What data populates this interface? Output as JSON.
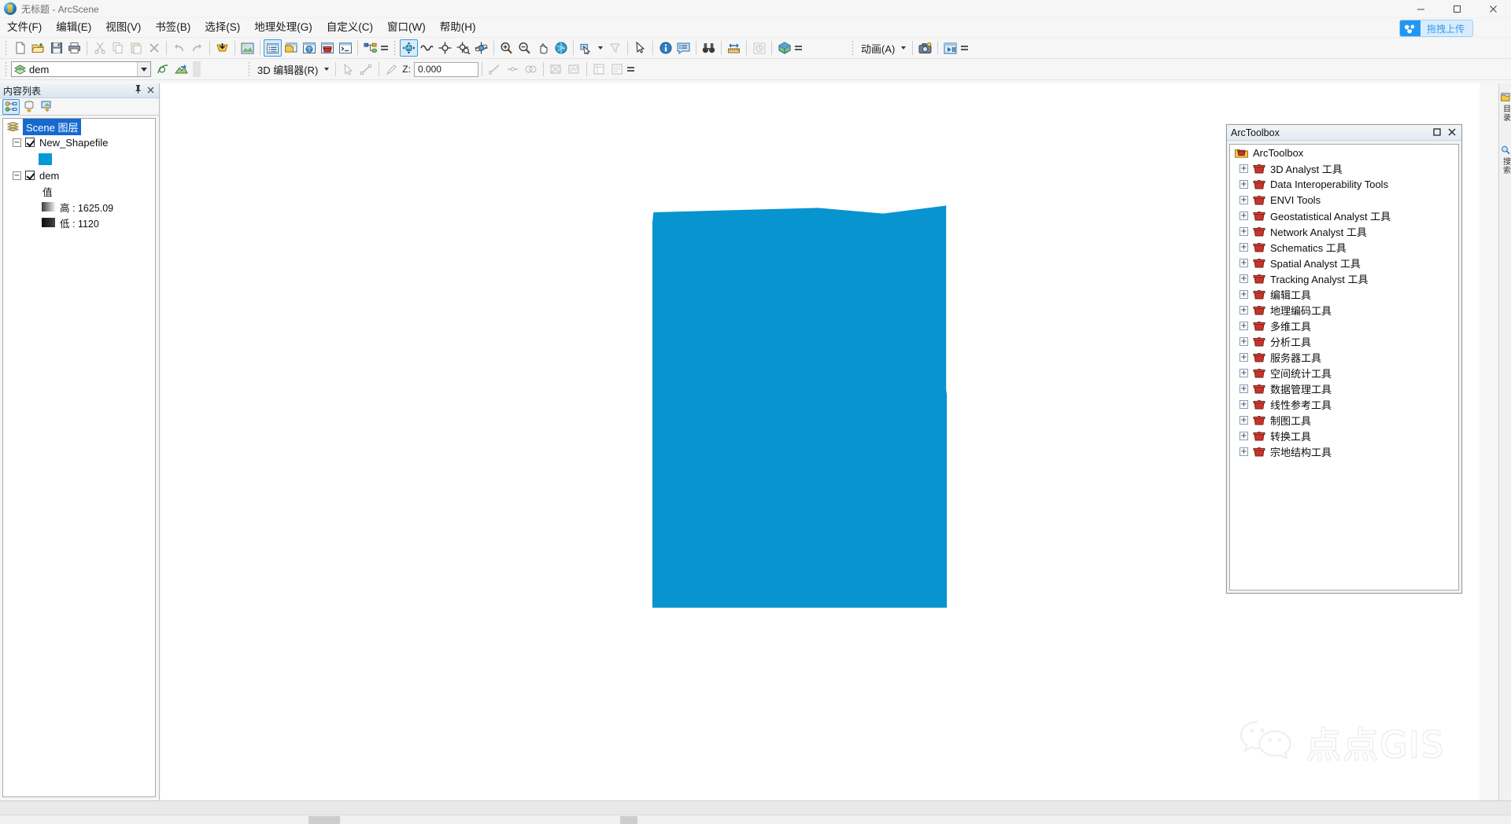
{
  "window": {
    "title": "无标题 - ArcScene",
    "app_icon": "arcscene-globe-icon",
    "minimize": "minimize-button",
    "maximize": "maximize-button",
    "close": "close-button"
  },
  "menubar": {
    "items": [
      {
        "label": "文件(F)",
        "name": "menu-file"
      },
      {
        "label": "编辑(E)",
        "name": "menu-edit"
      },
      {
        "label": "视图(V)",
        "name": "menu-view"
      },
      {
        "label": "书签(B)",
        "name": "menu-bookmarks"
      },
      {
        "label": "选择(S)",
        "name": "menu-selection"
      },
      {
        "label": "地理处理(G)",
        "name": "menu-geoprocessing"
      },
      {
        "label": "自定义(C)",
        "name": "menu-customize"
      },
      {
        "label": "窗口(W)",
        "name": "menu-window"
      },
      {
        "label": "帮助(H)",
        "name": "menu-help"
      }
    ],
    "upload_button": {
      "label": "拖拽上传",
      "icon": "baidu-netdisk-icon",
      "accent": "#2196f3",
      "background": "#d8ecff"
    }
  },
  "toolbar_standard": {
    "buttons": [
      {
        "name": "new-document-button",
        "icon": "new-document-icon"
      },
      {
        "name": "open-document-button",
        "icon": "open-folder-icon"
      },
      {
        "name": "save-document-button",
        "icon": "floppy-disk-icon"
      },
      {
        "name": "print-button",
        "icon": "printer-icon"
      },
      {
        "name": "cut-button",
        "icon": "scissors-icon"
      },
      {
        "name": "copy-button",
        "icon": "copy-icon"
      },
      {
        "name": "paste-button",
        "icon": "clipboard-paste-icon"
      },
      {
        "name": "delete-button",
        "icon": "x-delete-icon"
      },
      {
        "name": "undo-button",
        "icon": "undo-arrow-icon"
      },
      {
        "name": "redo-button",
        "icon": "redo-arrow-icon"
      },
      {
        "name": "add-data-button",
        "icon": "add-data-icon"
      },
      {
        "name": "base-layer-button",
        "icon": "picture-icon"
      },
      {
        "name": "table-of-contents-button",
        "icon": "toc-icon"
      },
      {
        "name": "catalog-button",
        "icon": "catalog-icon"
      },
      {
        "name": "search-window-button",
        "icon": "search-globe-icon"
      },
      {
        "name": "arctoolbox-button",
        "icon": "toolbox-icon"
      },
      {
        "name": "python-window-button",
        "icon": "python-console-icon"
      },
      {
        "name": "model-builder-button",
        "icon": "modelbuilder-icon"
      }
    ],
    "navigate_buttons": [
      {
        "name": "navigate-tool-button",
        "icon": "navigate-globe-icon"
      },
      {
        "name": "fly-tool-button",
        "icon": "fly-icon"
      },
      {
        "name": "center-on-target-button",
        "icon": "center-target-icon"
      },
      {
        "name": "zoom-to-target-button",
        "icon": "zoom-target-icon"
      },
      {
        "name": "set-observer-button",
        "icon": "observer-icon"
      },
      {
        "name": "zoom-in-button",
        "icon": "zoom-in-icon"
      },
      {
        "name": "zoom-out-button",
        "icon": "zoom-out-icon"
      },
      {
        "name": "zoom-in-tool-button",
        "icon": "magnifier-plus-icon"
      },
      {
        "name": "zoom-out-tool-button",
        "icon": "magnifier-minus-icon"
      },
      {
        "name": "pan-button",
        "icon": "hand-pan-icon"
      },
      {
        "name": "full-extent-button",
        "icon": "globe-full-extent-icon"
      },
      {
        "name": "select-features-button",
        "icon": "select-features-icon"
      },
      {
        "name": "clear-selection-button",
        "icon": "clear-selection-icon"
      },
      {
        "name": "select-elements-button",
        "icon": "arrow-pointer-icon"
      },
      {
        "name": "identify-button",
        "icon": "info-identify-icon"
      },
      {
        "name": "html-popup-button",
        "icon": "html-popup-icon"
      },
      {
        "name": "find-button",
        "icon": "binoculars-icon"
      },
      {
        "name": "measure-button",
        "icon": "measure-ruler-icon"
      },
      {
        "name": "time-slider-button",
        "icon": "clock-icon"
      },
      {
        "name": "scene-properties-button",
        "icon": "cube-icon"
      }
    ],
    "animation": {
      "label": "动画(A)",
      "buttons": [
        {
          "name": "capture-view-button",
          "icon": "camera-icon"
        },
        {
          "name": "animation-controls-button",
          "icon": "play-pause-icon"
        }
      ]
    }
  },
  "toolbar_3d_editor": {
    "layer_combo": {
      "value": "dem",
      "icon": "raster-layer-icon",
      "name": "layer-dropdown"
    },
    "extra_buttons": [
      {
        "name": "edit-vertices-button",
        "icon": "vertices-icon"
      },
      {
        "name": "drape-button",
        "icon": "drape-icon"
      }
    ],
    "label": "3D 编辑器(R)",
    "z_label": "Z:",
    "z_value": "0.000",
    "z_placeholder": "0.000",
    "buttons": [
      {
        "name": "edit-tool-button",
        "icon": "edit-pointer-icon"
      },
      {
        "name": "edit-vertices-tool-button",
        "icon": "edit-vertices-icon"
      },
      {
        "name": "sketch-tool-button",
        "icon": "sketch-pencil-icon"
      },
      {
        "name": "straight-segment-button",
        "icon": "straight-segment-icon"
      },
      {
        "name": "midpoint-button",
        "icon": "midpoint-icon"
      },
      {
        "name": "distance-distance-button",
        "icon": "distance-distance-icon"
      },
      {
        "name": "intersection-button",
        "icon": "intersection-icon"
      },
      {
        "name": "trace-button",
        "icon": "trace-icon"
      },
      {
        "name": "attributes-button",
        "icon": "attributes-icon"
      },
      {
        "name": "sketch-properties-button",
        "icon": "sketch-properties-icon"
      }
    ]
  },
  "toc": {
    "title": "内容列表",
    "pin_icon": "pin-icon",
    "close_icon": "close-icon",
    "tools": [
      {
        "name": "list-by-drawing-order-button",
        "icon": "list-drawing-order-icon",
        "selected": true
      },
      {
        "name": "list-by-source-button",
        "icon": "list-source-icon",
        "selected": false
      },
      {
        "name": "list-by-selection-button",
        "icon": "list-selection-icon",
        "selected": false
      }
    ],
    "tree": {
      "root": "Scene 图层",
      "root_icon": "scene-layers-icon",
      "layers": [
        {
          "name": "New_Shapefile",
          "checked": true,
          "symbol_color": "#0099d6",
          "symbol_name": "polygon-swatch"
        },
        {
          "name": "dem",
          "checked": true,
          "value_header": "值",
          "high_label": "高 : 1625.09",
          "low_label": "低 : 1120"
        }
      ]
    }
  },
  "arctoolbox": {
    "title": "ArcToolbox",
    "maximize_icon": "restore-icon",
    "close_icon": "close-icon",
    "root": {
      "label": "ArcToolbox",
      "icon": "arctoolbox-root-icon"
    },
    "items": [
      {
        "label": "3D Analyst 工具",
        "icon": "toolbox-icon"
      },
      {
        "label": "Data Interoperability Tools",
        "icon": "toolbox-icon"
      },
      {
        "label": "ENVI Tools",
        "icon": "toolbox-icon"
      },
      {
        "label": "Geostatistical Analyst 工具",
        "icon": "toolbox-icon"
      },
      {
        "label": "Network Analyst 工具",
        "icon": "toolbox-icon"
      },
      {
        "label": "Schematics 工具",
        "icon": "toolbox-icon"
      },
      {
        "label": "Spatial Analyst 工具",
        "icon": "toolbox-icon"
      },
      {
        "label": "Tracking Analyst 工具",
        "icon": "toolbox-icon"
      },
      {
        "label": "编辑工具",
        "icon": "toolbox-icon"
      },
      {
        "label": "地理编码工具",
        "icon": "toolbox-icon"
      },
      {
        "label": "多维工具",
        "icon": "toolbox-icon"
      },
      {
        "label": "分析工具",
        "icon": "toolbox-icon"
      },
      {
        "label": "服务器工具",
        "icon": "toolbox-icon"
      },
      {
        "label": "空间统计工具",
        "icon": "toolbox-icon"
      },
      {
        "label": "数据管理工具",
        "icon": "toolbox-icon"
      },
      {
        "label": "线性参考工具",
        "icon": "toolbox-icon"
      },
      {
        "label": "制图工具",
        "icon": "toolbox-icon"
      },
      {
        "label": "转换工具",
        "icon": "toolbox-icon"
      },
      {
        "label": "宗地结构工具",
        "icon": "toolbox-icon"
      }
    ]
  },
  "right_dock": {
    "tabs": [
      {
        "label": "目录",
        "name": "catalog-dock-tab",
        "icon": "catalog-icon"
      },
      {
        "label": "搜索",
        "name": "search-dock-tab",
        "icon": "search-icon"
      }
    ]
  },
  "scene": {
    "dem_fill": "#0894ce",
    "background": "#ffffff",
    "watermark": "点点GIS",
    "watermark_icon": "wechat-icon"
  },
  "statusbar": {
    "text": ""
  }
}
